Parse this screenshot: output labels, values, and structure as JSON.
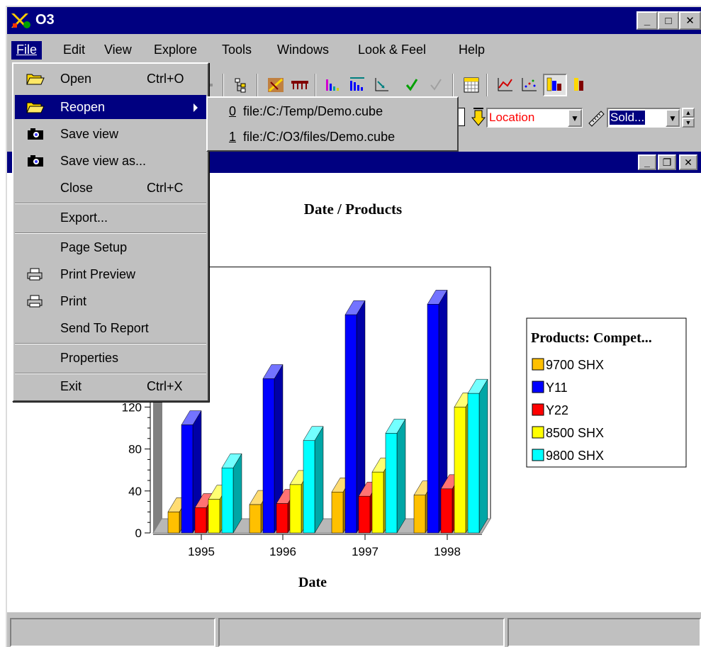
{
  "window": {
    "title": "O3"
  },
  "menubar": [
    "File",
    "Edit",
    "View",
    "Explore",
    "Tools",
    "Windows",
    "Look & Feel",
    "Help"
  ],
  "file_menu": {
    "items": [
      {
        "label": "Open",
        "shortcut": "Ctrl+O",
        "icon": "folder-open-icon"
      },
      {
        "label": "Reopen",
        "shortcut": "",
        "icon": "folder-open-icon",
        "selected": true,
        "has_submenu": true
      },
      {
        "label": "Save view",
        "shortcut": "",
        "icon": "camera-icon"
      },
      {
        "label": "Save view as...",
        "shortcut": "",
        "icon": "camera-icon"
      },
      {
        "label": "Close",
        "shortcut": "Ctrl+C"
      },
      {
        "label": "Export...",
        "shortcut": ""
      },
      {
        "label": "Page Setup",
        "shortcut": ""
      },
      {
        "label": "Print Preview",
        "shortcut": "",
        "icon": "printer-icon"
      },
      {
        "label": "Print",
        "shortcut": "",
        "icon": "printer-icon"
      },
      {
        "label": "Send To Report",
        "shortcut": ""
      },
      {
        "label": "Properties",
        "shortcut": ""
      },
      {
        "label": "Exit",
        "shortcut": "Ctrl+X"
      }
    ]
  },
  "reopen_submenu": [
    {
      "num": "0",
      "path": "file:/C:/Temp/Demo.cube"
    },
    {
      "num": "1",
      "path": "file:/C:/O3/files/Demo.cube"
    }
  ],
  "toolbar": {
    "location_combo": "Location",
    "measure_combo": "Sold..."
  },
  "colors": {
    "title_bar": "#000080",
    "chrome": "#c0c0c0"
  },
  "chart_data": {
    "type": "bar",
    "title": "Date / Products",
    "xlabel": "Date",
    "ylabel": "",
    "categories": [
      "1995",
      "1996",
      "1997",
      "1998"
    ],
    "yticks": [
      "0",
      "40",
      "80",
      "120"
    ],
    "ylim": [
      0,
      240
    ],
    "legend_title": "Products: Compet...",
    "series": [
      {
        "name": "9700 SHX",
        "color": "#ffc000",
        "values": [
          20,
          27,
          39,
          36
        ]
      },
      {
        "name": "Y11",
        "color": "#0000ff",
        "values": [
          103,
          147,
          208,
          218
        ]
      },
      {
        "name": "Y22",
        "color": "#ff0000",
        "values": [
          24,
          28,
          35,
          42
        ]
      },
      {
        "name": "8500 SHX",
        "color": "#ffff00",
        "values": [
          32,
          46,
          58,
          120
        ]
      },
      {
        "name": "9800 SHX",
        "color": "#00ffff",
        "values": [
          62,
          88,
          95,
          133
        ]
      }
    ]
  }
}
